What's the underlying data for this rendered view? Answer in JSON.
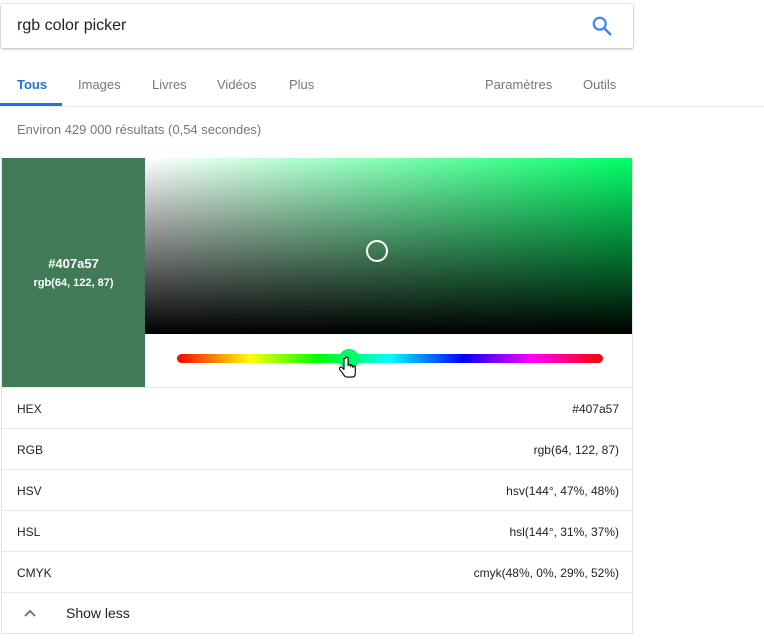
{
  "search": {
    "query": "rgb color picker",
    "button_icon": "search-icon"
  },
  "tabs": [
    {
      "label": "Tous",
      "active": true
    },
    {
      "label": "Images",
      "active": false
    },
    {
      "label": "Livres",
      "active": false
    },
    {
      "label": "Vidéos",
      "active": false
    },
    {
      "label": "Plus",
      "active": false
    },
    {
      "label": "Paramètres",
      "active": false
    },
    {
      "label": "Outils",
      "active": false
    }
  ],
  "result_stats": "Environ 429 000 résultats (0,54 secondes)",
  "color_picker": {
    "selected_color": "#407a57",
    "hue_color": "#00ff66",
    "accent_color": "#1a73e8",
    "swatch_hex": "#407a57",
    "swatch_rgb": "rgb(64, 122, 87)",
    "hue_degrees": 144,
    "formats": [
      {
        "label": "HEX",
        "value": "#407a57"
      },
      {
        "label": "RGB",
        "value": "rgb(64, 122, 87)"
      },
      {
        "label": "HSV",
        "value": "hsv(144°, 47%, 48%)"
      },
      {
        "label": "HSL",
        "value": "hsl(144°, 31%, 37%)"
      },
      {
        "label": "CMYK",
        "value": "cmyk(48%, 0%, 29%, 52%)"
      }
    ],
    "show_less_label": "Show less",
    "show_less_icon": "chevron-up-icon",
    "hue_handle_cursor": "hand-pointer-icon"
  }
}
